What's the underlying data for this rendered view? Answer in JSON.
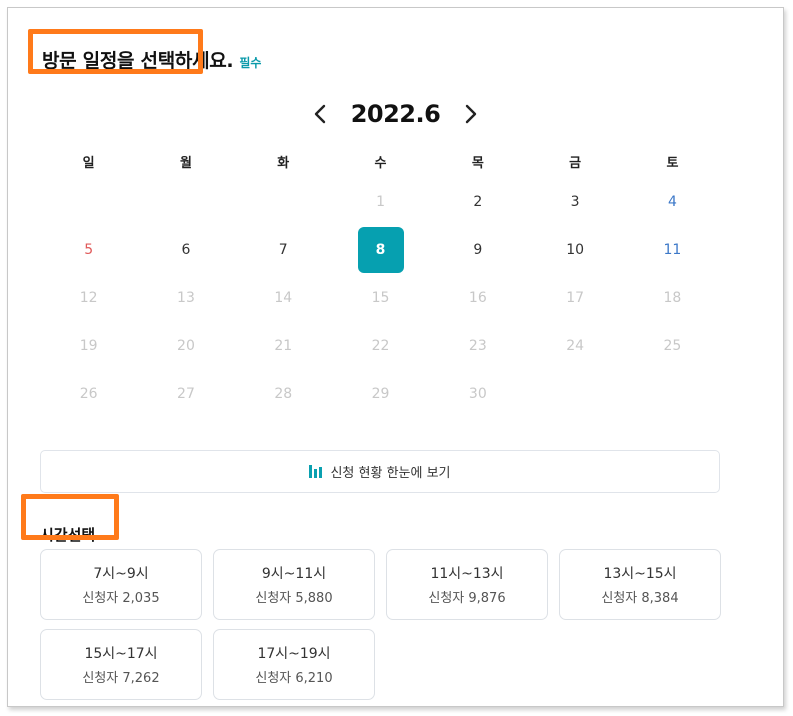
{
  "header": {
    "title": "방문 일정을 선택하세요.",
    "required_label": "필수"
  },
  "calendar": {
    "month_label": "2022.6",
    "prev_icon": "chevron-left-icon",
    "next_icon": "chevron-right-icon",
    "weekdays": [
      "일",
      "월",
      "화",
      "수",
      "목",
      "금",
      "토"
    ],
    "weeks": [
      [
        "",
        "",
        "",
        "1",
        "2",
        "3",
        "4"
      ],
      [
        "5",
        "6",
        "7",
        "8",
        "9",
        "10",
        "11"
      ],
      [
        "12",
        "13",
        "14",
        "15",
        "16",
        "17",
        "18"
      ],
      [
        "19",
        "20",
        "21",
        "22",
        "23",
        "24",
        "25"
      ],
      [
        "26",
        "27",
        "28",
        "29",
        "30",
        "",
        ""
      ]
    ],
    "selected_day": "8",
    "colors": {
      "selected_bg": "#06a0b0",
      "sunday": "#e05a5a",
      "saturday": "#3c78c8",
      "disabled": "#c8c8c8",
      "highlight_box": "#ff7a1a"
    }
  },
  "status_button": {
    "label": "신청 현황 한눈에 보기",
    "icon": "bar-chart-icon"
  },
  "time_section": {
    "title": "시간선택",
    "slots": [
      {
        "time": "7시~9시",
        "count": "신청자 2,035"
      },
      {
        "time": "9시~11시",
        "count": "신청자 5,880"
      },
      {
        "time": "11시~13시",
        "count": "신청자 9,876"
      },
      {
        "time": "13시~15시",
        "count": "신청자 8,384"
      },
      {
        "time": "15시~17시",
        "count": "신청자 7,262"
      },
      {
        "time": "17시~19시",
        "count": "신청자 6,210"
      }
    ]
  }
}
